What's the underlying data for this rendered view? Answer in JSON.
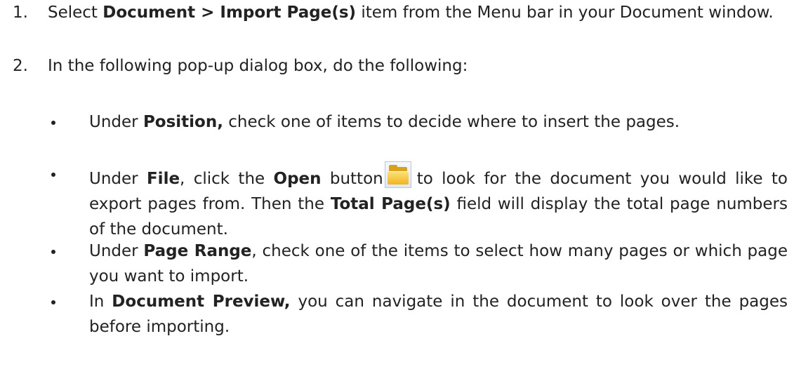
{
  "steps": [
    {
      "num": "1.",
      "pre": "Select ",
      "bold": "Document > Import Page(s)",
      "post": " item from the Menu bar in your Document window."
    },
    {
      "num": "2.",
      "text": "In the following pop-up dialog box, do the following:"
    }
  ],
  "bullets": [
    {
      "pre": "Under ",
      "bold": "Position,",
      "post": " check one of items to decide where to insert the pages."
    },
    {
      "pre": "Under ",
      "bold": "File",
      "mid": ", click the ",
      "bold2": "Open",
      "mid2": " button",
      "icon": "open-folder-icon",
      "post": "to look for the document you would like to export pages from. Then the ",
      "bold3": "Total Page(s)",
      "post2": " field will display the total page numbers of the document."
    },
    {
      "pre": "Under ",
      "bold": "Page Range",
      "post": ", check one of the items to select how many pages or which page you want to import."
    },
    {
      "pre": "In ",
      "bold": "Document Preview,",
      "post": " you can navigate in the document to look over the pages before importing."
    }
  ]
}
